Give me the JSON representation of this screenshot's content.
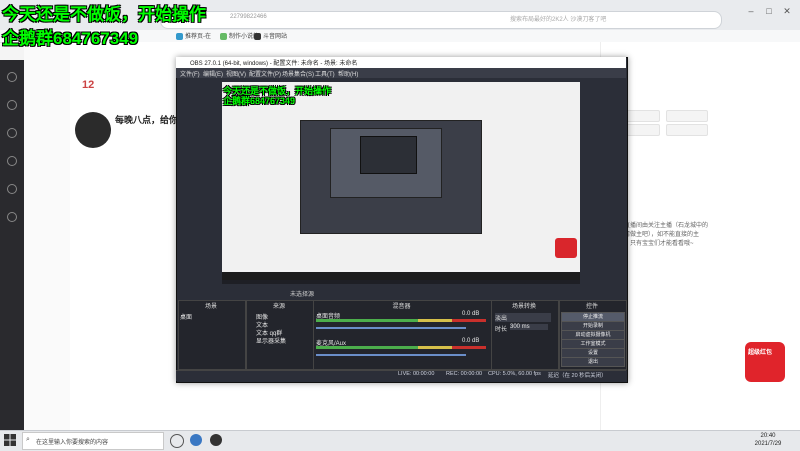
{
  "overlay": {
    "line1": "今天还是不做饭，开始操作",
    "line2": "企鹅群684767349"
  },
  "browser": {
    "address_fragment": "22799822466",
    "search_hint": "搜索布局最好的2K2人 沙漠刀客了吧",
    "bookmarks": [
      "推荐页-在",
      "制作小说的",
      "斗音网站"
    ]
  },
  "page": {
    "level_number": "12",
    "streamer_title": "每晚八点，给你不",
    "right_side_chat": "本直播间由关注主播（石龙城中的心情做主吧），如不能直接的主播，只有宝宝们才能看看哦~"
  },
  "obs": {
    "title": "OBS 27.0.1 (64-bit, windows) - 配置文件: 未命名 - 场景: 未命名",
    "menu": [
      "文件(F)",
      "编辑(E)",
      "视图(V)",
      "配置文件(P)",
      "场景集合(S)",
      "工具(T)",
      "帮助(H)"
    ],
    "preview_watermark1": "今天还是不做饭，开始操作",
    "preview_watermark2": "企鹅群684767349",
    "mode_tabs": "未选择源",
    "docks": {
      "scenes_title": "场景",
      "sources_title": "来源",
      "mixer_title": "混音器",
      "transitions_title": "场景转换",
      "controls_title": "控件"
    },
    "scene_item": "桌面",
    "sources": [
      "图像",
      "文本",
      "文本 qq群",
      "显示器采集"
    ],
    "mixer": [
      {
        "name": "桌面音频",
        "db": "0.0 dB"
      },
      {
        "name": "麦克风/Aux",
        "db": "0.0 dB"
      }
    ],
    "transition": {
      "type": "淡出",
      "duration_label": "时长",
      "duration": "300 ms"
    },
    "controls": [
      "停止推流",
      "开始录制",
      "启动虚拟摄像机",
      "工作室模式",
      "设置",
      "退出"
    ],
    "status": {
      "live": "LIVE: 00:00:00",
      "rec": "REC: 00:00:00",
      "cpu": "CPU: 5.0%, 60.00 fps",
      "frames": "延迟（在 20 秒后关闭）"
    }
  },
  "taskbar": {
    "search": "在这里输入你要搜索的内容",
    "time": "20:40",
    "date": "2021/7/29"
  },
  "gift": {
    "label": "超级红包"
  },
  "colors": {
    "overlay_text": "#00ff00",
    "obs_bg": "#2b2e38",
    "gift_red": "#e0242b"
  }
}
